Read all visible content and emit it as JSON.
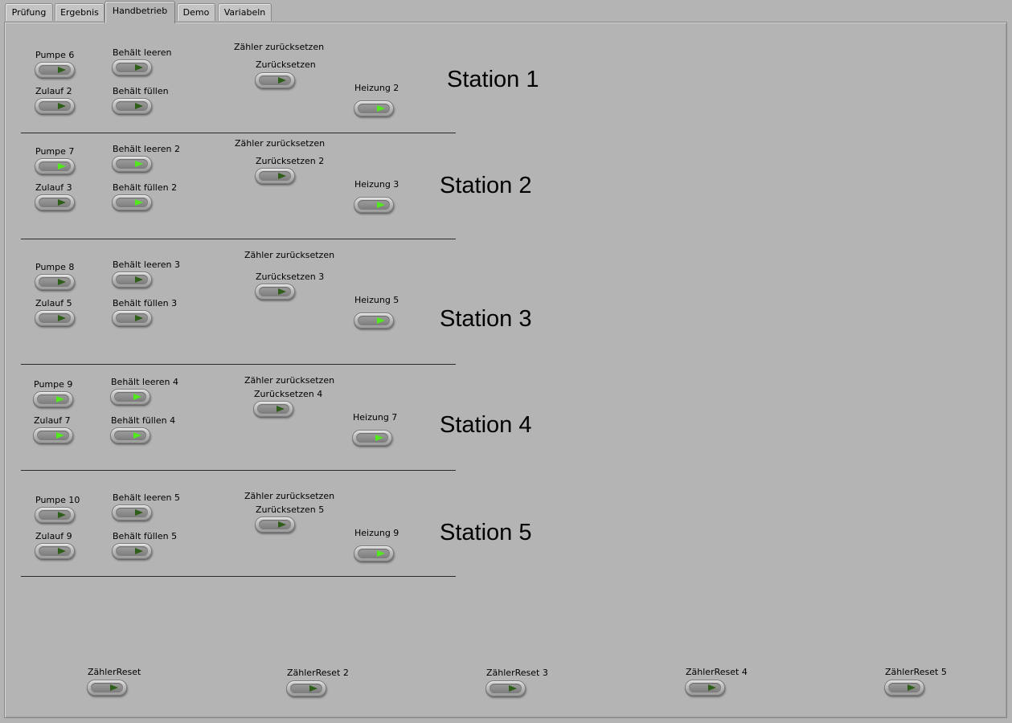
{
  "tabs": [
    "Prüfung",
    "Ergebnis",
    "Handbetrieb",
    "Demo",
    "Variabeln"
  ],
  "active_tab": "Handbetrieb",
  "stations": [
    {
      "title": "Station 1",
      "pumpe": "Pumpe 6",
      "pumpe_on": false,
      "zulauf": "Zulauf 2",
      "zulauf_on": false,
      "leeren": "Behält leeren",
      "leeren_on": false,
      "fuellen": "Behält füllen",
      "fuellen_on": false,
      "zaehler_caption": "Zähler zurücksetzen",
      "zurueck": "Zurücksetzen",
      "zurueck_on": false,
      "heizung": "Heizung 2",
      "heizung_on": true
    },
    {
      "title": "Station 2",
      "pumpe": "Pumpe 7",
      "pumpe_on": true,
      "zulauf": "Zulauf 3",
      "zulauf_on": false,
      "leeren": "Behält leeren 2",
      "leeren_on": true,
      "fuellen": "Behält füllen 2",
      "fuellen_on": true,
      "zaehler_caption": "Zähler zurücksetzen",
      "zurueck": "Zurücksetzen 2",
      "zurueck_on": false,
      "heizung": "Heizung 3",
      "heizung_on": true
    },
    {
      "title": "Station 3",
      "pumpe": "Pumpe 8",
      "pumpe_on": false,
      "zulauf": "Zulauf 5",
      "zulauf_on": false,
      "leeren": "Behält leeren 3",
      "leeren_on": false,
      "fuellen": "Behält füllen 3",
      "fuellen_on": false,
      "zaehler_caption": "Zähler zurücksetzen",
      "zurueck": "Zurücksetzen 3",
      "zurueck_on": false,
      "heizung": "Heizung 5",
      "heizung_on": true
    },
    {
      "title": "Station 4",
      "pumpe": "Pumpe 9",
      "pumpe_on": true,
      "zulauf": "Zulauf 7",
      "zulauf_on": true,
      "leeren": "Behält leeren 4",
      "leeren_on": true,
      "fuellen": "Behält füllen 4",
      "fuellen_on": true,
      "zaehler_caption": "Zähler zurücksetzen",
      "zurueck": "Zurücksetzen 4",
      "zurueck_on": false,
      "heizung": "Heizung 7",
      "heizung_on": true
    },
    {
      "title": "Station 5",
      "pumpe": "Pumpe 10",
      "pumpe_on": false,
      "zulauf": "Zulauf 9",
      "zulauf_on": false,
      "leeren": "Behält leeren 5",
      "leeren_on": false,
      "fuellen": "Behält füllen 5",
      "fuellen_on": false,
      "zaehler_caption": "Zähler zurücksetzen",
      "zurueck": "Zurücksetzen 5",
      "zurueck_on": false,
      "heizung": "Heizung 9",
      "heizung_on": true
    }
  ],
  "resets": [
    {
      "label": "ZählerReset",
      "on": false
    },
    {
      "label": "ZählerReset 2",
      "on": false
    },
    {
      "label": "ZählerReset 3",
      "on": false
    },
    {
      "label": "ZählerReset 4",
      "on": false
    },
    {
      "label": "ZählerReset 5",
      "on": false
    }
  ],
  "colors": {
    "background": "#b4b4b4",
    "led_on": "#52e81e",
    "led_off": "#2f5e1a"
  }
}
